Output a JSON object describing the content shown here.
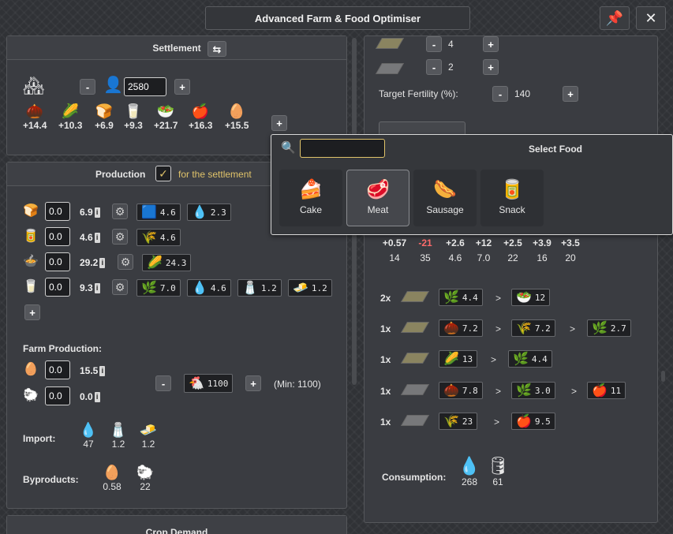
{
  "window": {
    "title": "Advanced Farm & Food Optimiser",
    "pin_label": "📌",
    "close_label": "✕"
  },
  "settlement": {
    "header": "Settlement",
    "population": "2580",
    "minus": "-",
    "plus": "+",
    "resources": [
      {
        "icon": "🌰",
        "value": "+14.4"
      },
      {
        "icon": "🌽",
        "value": "+10.3"
      },
      {
        "icon": "🍞",
        "value": "+6.9"
      },
      {
        "icon": "🥛",
        "value": "+9.3"
      },
      {
        "icon": "🥗",
        "value": "+21.7"
      },
      {
        "icon": "🍎",
        "value": "+16.3"
      },
      {
        "icon": "🥚",
        "value": "+15.5"
      }
    ],
    "add": "+"
  },
  "production": {
    "header": "Production",
    "checkbox_label": "for the settlement",
    "check_mark": "✓",
    "rows": [
      {
        "icon": "🍞",
        "input": "0.0",
        "value": "6.9",
        "chips": [
          {
            "icon": "🟦",
            "v": "4.6"
          },
          {
            "icon": "💧",
            "v": "2.3"
          }
        ]
      },
      {
        "icon": "🥫",
        "input": "0.0",
        "value": "4.6",
        "chips": [
          {
            "icon": "🌾",
            "v": "4.6"
          }
        ]
      },
      {
        "icon": "🍲",
        "input": "0.0",
        "value": "29.2",
        "chips": [
          {
            "icon": "🌽",
            "v": "24.3"
          }
        ]
      },
      {
        "icon": "🥛",
        "input": "0.0",
        "value": "9.3",
        "chips": [
          {
            "icon": "🌿",
            "v": "7.0"
          },
          {
            "icon": "💧",
            "v": "4.6"
          },
          {
            "icon": "🧂",
            "v": "1.2"
          },
          {
            "icon": "🧈",
            "v": "1.2"
          }
        ]
      }
    ],
    "add": "+",
    "info": "i",
    "gear": "⚙",
    "farm_label": "Farm Production:",
    "farm_rows": [
      {
        "icon": "🥚",
        "input": "0.0",
        "value": "15.5"
      },
      {
        "icon": "🐑",
        "input": "0.0",
        "value": "0.0"
      }
    ],
    "animals": "1100",
    "animal_icon": "🐔",
    "animals_min": "(Min: 1100)",
    "import_label": "Import:",
    "imports": [
      {
        "icon": "💧",
        "v": "47"
      },
      {
        "icon": "🧂",
        "v": "1.2"
      },
      {
        "icon": "🧈",
        "v": "1.2"
      }
    ],
    "byproducts_label": "Byproducts:",
    "byproducts": [
      {
        "icon": "🥚",
        "v": "0.58"
      },
      {
        "icon": "🐑",
        "v": "22"
      }
    ],
    "crop_demand": "Crop Demand"
  },
  "right": {
    "fields": [
      {
        "v": "4"
      },
      {
        "v": "2"
      }
    ],
    "fertility_label": "Target Fertility (%):",
    "fertility": "140",
    "summary_top": [
      "+0.57",
      "-21",
      "+2.6",
      "+12",
      "+2.5",
      "+3.9",
      "+3.5"
    ],
    "summary_bottom": [
      "14",
      "35",
      "4.6",
      "7.0",
      "22",
      "16",
      "20"
    ],
    "rotations": [
      {
        "mult": "2x",
        "steps": [
          {
            "icon": "🌿",
            "v": "4.4"
          },
          {
            "icon": "🥗",
            "v": "12"
          }
        ]
      },
      {
        "mult": "1x",
        "steps": [
          {
            "icon": "🌰",
            "v": "7.2"
          },
          {
            "icon": "🌾",
            "v": "7.2"
          },
          {
            "icon": "🌿",
            "v": "2.7"
          }
        ]
      },
      {
        "mult": "1x",
        "steps": [
          {
            "icon": "🌽",
            "v": "13"
          },
          {
            "icon": "🌿",
            "v": "4.4"
          }
        ]
      },
      {
        "mult": "1x",
        "steps": [
          {
            "icon": "🌰",
            "v": "7.8"
          },
          {
            "icon": "🌿",
            "v": "3.0"
          },
          {
            "icon": "🍎",
            "v": "11"
          }
        ]
      },
      {
        "mult": "1x",
        "steps": [
          {
            "icon": "🌾",
            "v": "23"
          },
          {
            "icon": "🍎",
            "v": "9.5"
          }
        ]
      }
    ],
    "arrow": ">",
    "consumption_label": "Consumption:",
    "consumption": [
      {
        "icon": "💧",
        "v": "268"
      },
      {
        "icon": "🛢",
        "v": "61"
      }
    ]
  },
  "popup": {
    "title": "Select Food",
    "search_icon": "🔍",
    "search_value": "",
    "foods": [
      {
        "icon": "🍰",
        "label": "Cake"
      },
      {
        "icon": "🥩",
        "label": "Meat"
      },
      {
        "icon": "🌭",
        "label": "Sausage"
      },
      {
        "icon": "🥫",
        "label": "Snack"
      }
    ]
  },
  "colors": {
    "negative": "#ff6b6b",
    "accent": "#e0c36a"
  }
}
